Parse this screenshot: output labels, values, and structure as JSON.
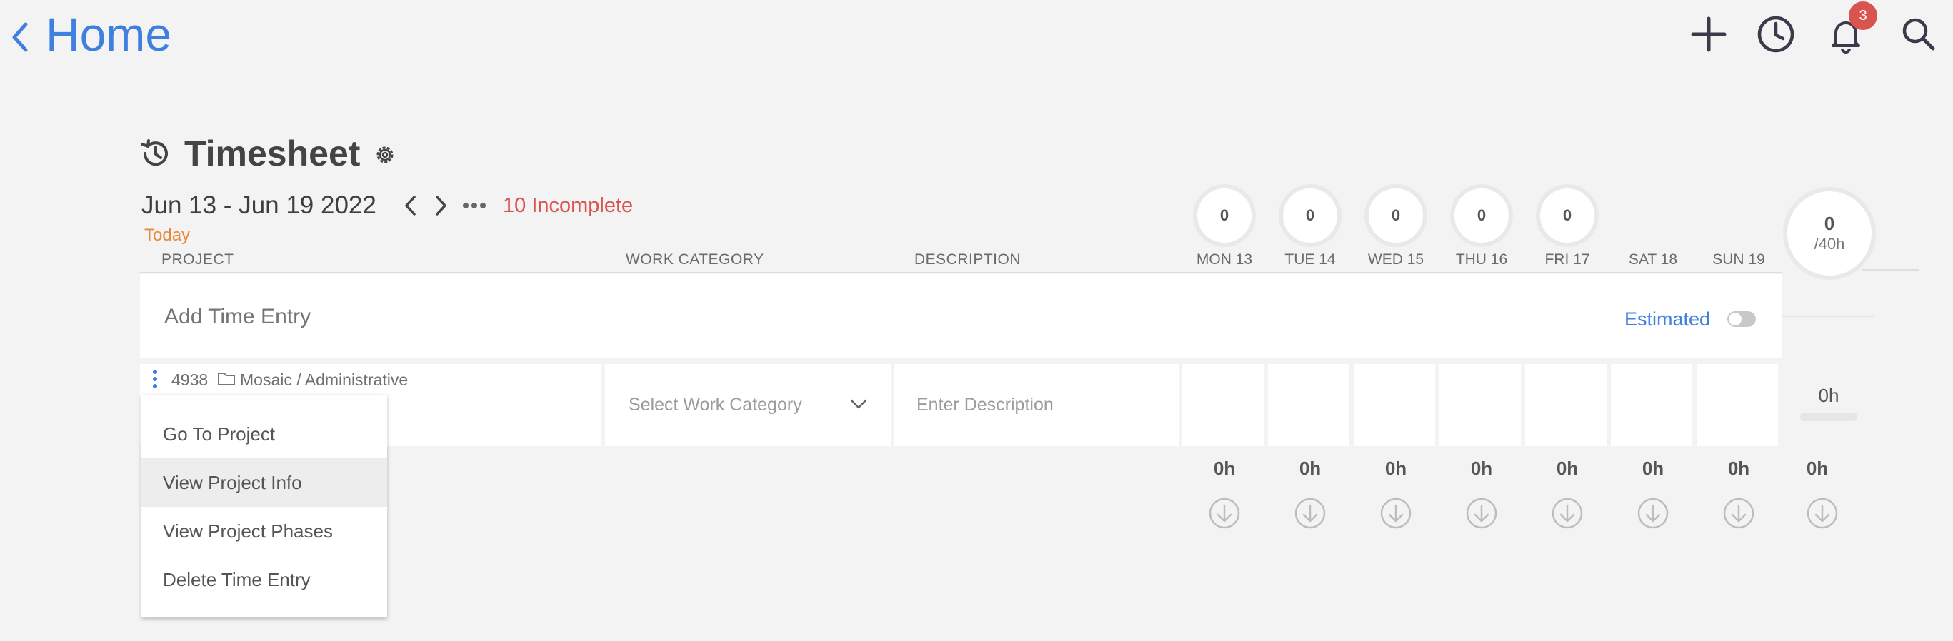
{
  "nav": {
    "back_label": "Home",
    "notification_count": "3",
    "icons": [
      "chevron-left-icon",
      "plus-icon",
      "clock-icon",
      "bell-icon",
      "search-icon"
    ]
  },
  "timesheet": {
    "title": "Timesheet",
    "date_range": "Jun 13 - Jun 19 2022",
    "incomplete": "10 Incomplete",
    "today": "Today",
    "columns": {
      "project": "PROJECT",
      "work_category": "WORK CATEGORY",
      "description": "DESCRIPTION"
    },
    "days": [
      {
        "label": "MON 13",
        "circle": "0",
        "total": "0h"
      },
      {
        "label": "TUE 14",
        "circle": "0",
        "total": "0h"
      },
      {
        "label": "WED 15",
        "circle": "0",
        "total": "0h"
      },
      {
        "label": "THU 16",
        "circle": "0",
        "total": "0h"
      },
      {
        "label": "FRI 17",
        "circle": "0",
        "total": "0h"
      },
      {
        "label": "SAT 18",
        "total": "0h"
      },
      {
        "label": "SUN 19",
        "total": "0h"
      }
    ],
    "week_total": {
      "value": "0",
      "target": "/40h"
    },
    "add_entry_label": "Add Time Entry",
    "estimated_label": "Estimated",
    "estimated_on": false,
    "entry": {
      "project_number": "4938",
      "project_path": "Mosaic / Administrative",
      "work_category_placeholder": "Select Work Category",
      "description_placeholder": "Enter Description",
      "row_total": "0h"
    },
    "grand_total": "0h"
  },
  "context_menu": {
    "items": [
      "Go To Project",
      "View Project Info",
      "View Project Phases",
      "Delete Time Entry"
    ],
    "highlighted_index": 1
  },
  "colors": {
    "accent": "#3f7fe0",
    "incomplete": "#d9534f",
    "today": "#e58b3a",
    "badge": "#d9534f"
  }
}
